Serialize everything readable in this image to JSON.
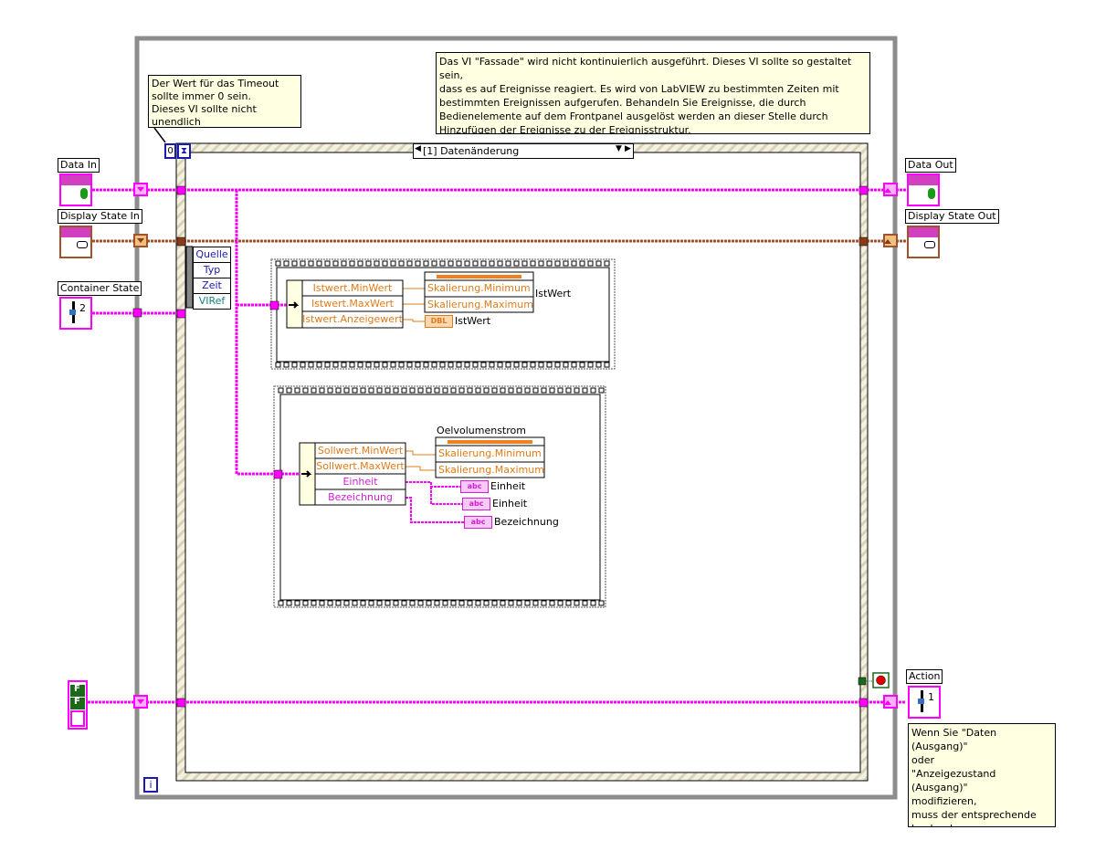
{
  "comments": {
    "top": "Das VI \"Fassade\" wird nicht kontinuierlich ausgeführt. Dieses VI sollte so gestaltet sein,\ndass es auf Ereignisse reagiert.  Es wird von LabVIEW zu bestimmten Zeiten mit\nbestimmten Ereignissen aufgerufen. Behandeln Sie Ereignisse, die durch\nBedienelemente auf dem Frontpanel ausgelöst werden an dieser Stelle durch\nHinzufügen der Ereignisse zu der Ereignisstruktur.",
    "timeout": "Der Wert für das Timeout\nsollte immer 0 sein.\nDieses VI sollte nicht unendlich\nwarten.",
    "action": "Wenn Sie \"Daten (Ausgang)\"\noder\n\"Anzeigezustand (Ausgang)\"\nmodifizieren,\nmuss der entsprechende\nboolesche\nWert in Aktion auf TRUE\ngesetzt werden."
  },
  "terminals": {
    "data_in": "Data In",
    "display_state_in": "Display State In",
    "container_state": "Container State",
    "data_out": "Data Out",
    "display_state_out": "Display State Out",
    "action": "Action",
    "action_value": "1",
    "container_value": "2",
    "bool_values": [
      "F",
      "F"
    ]
  },
  "event_structure": {
    "timeout_value": "0",
    "case_selector": "[1] Datenänderung",
    "event_data": [
      "Quelle",
      "Typ",
      "Zeit",
      "VIRef"
    ]
  },
  "loop": {
    "iteration": "i"
  },
  "frame1": {
    "unbundle": [
      "Istwert.MinWert",
      "Istwert.MaxWert",
      "Istwert.Anzeigewert"
    ],
    "property_node": [
      "Skalierung.Minimum",
      "Skalierung.Maximum"
    ],
    "property_label": "IstWert",
    "indicator_type": "DBL",
    "indicator_label": "IstWert"
  },
  "frame2": {
    "unbundle": [
      "Sollwert.MinWert",
      "Sollwert.MaxWert",
      "Einheit",
      "Bezeichnung"
    ],
    "property_label": "Oelvolumenstrom",
    "property_node": [
      "Skalierung.Minimum",
      "Skalierung.Maximum"
    ],
    "indicator_type": "abc",
    "indicators": [
      "Einheit",
      "Einheit",
      "Bezeichnung"
    ]
  },
  "colors": {
    "pink_wire": "#ff00ff",
    "brown_wire": "#a0522d",
    "orange_wire": "#e07b18",
    "loop_gray": "#8c8c8c",
    "comment_bg": "#ffffe1"
  }
}
